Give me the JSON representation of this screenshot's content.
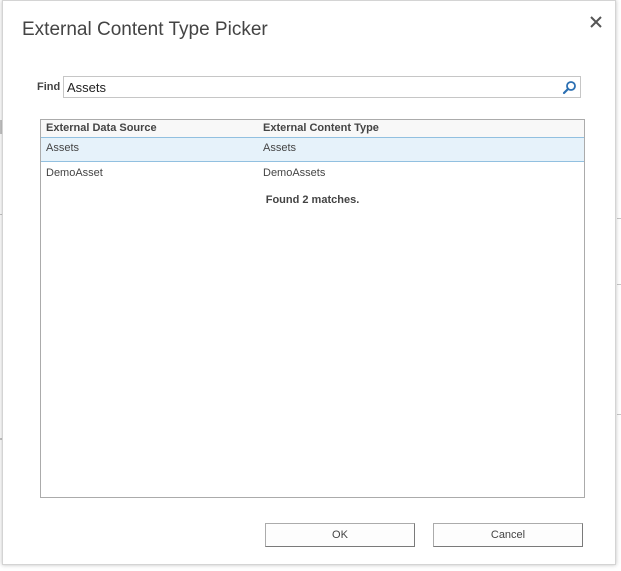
{
  "dialog": {
    "title": "External Content Type Picker",
    "close_icon": "close-icon"
  },
  "find": {
    "label": "Find",
    "value": "Assets",
    "search_icon": "search-icon"
  },
  "results": {
    "columns": [
      "External Data Source",
      "External Content Type"
    ],
    "rows": [
      {
        "source": "Assets",
        "type": "Assets",
        "selected": true
      },
      {
        "source": "DemoAsset",
        "type": "DemoAssets",
        "selected": false
      }
    ],
    "status": "Found 2 matches."
  },
  "buttons": {
    "ok_label": "OK",
    "cancel_label": "Cancel"
  },
  "colors": {
    "selected_row_bg": "#e6f2fa",
    "selected_row_border": "#92c0e0",
    "search_icon": "#2b6fb2"
  }
}
